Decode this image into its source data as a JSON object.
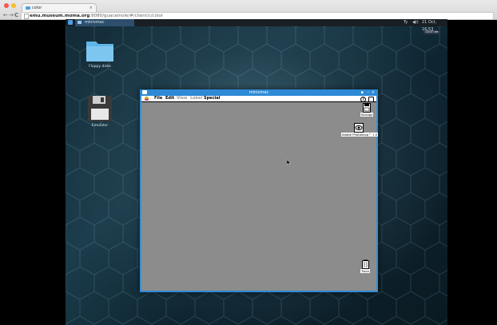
{
  "browser": {
    "tab_title": "color",
    "tab_close": "×",
    "back": "←",
    "forward": "→",
    "reload": "C",
    "url_host": "emu.museum.moma.org",
    "url_path": ":8080/guacamole/#/client/c/color"
  },
  "topbar": {
    "task_label": "minivmac",
    "tray_keyboard": "Ty",
    "tray_volume": "◀))",
    "tray_clock": "21 Oct, 16:53",
    "user_label": "dash ▸▸"
  },
  "desktop": {
    "icons": [
      {
        "label": "Floppy disks"
      },
      {
        "label": "Emulator"
      }
    ]
  },
  "window": {
    "title": "minivmac",
    "ctrl_pin": "▪",
    "ctrl_min": "–",
    "ctrl_close": "×"
  },
  "mac": {
    "menu": {
      "file": "File",
      "edit": "Edit",
      "view": "View",
      "label": "Label",
      "special": "Special"
    },
    "menu_right_help": "?",
    "icons": {
      "storage": "Storage",
      "photoshop": "Adobe Photoshop™ 1.0",
      "trash": "Trash"
    }
  }
}
